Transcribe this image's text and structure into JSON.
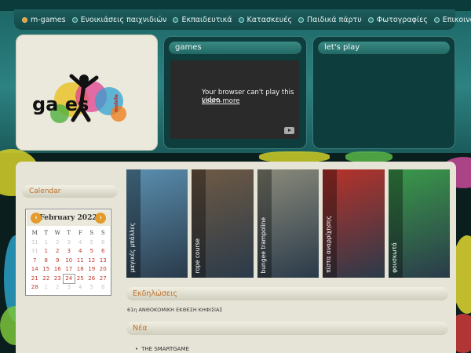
{
  "nav": {
    "items": [
      {
        "label": "m-games"
      },
      {
        "label": "Ενοικιάσεις παιχνιδιών"
      },
      {
        "label": "Εκπαιδευτικά"
      },
      {
        "label": "Κατασκευές"
      },
      {
        "label": "Παιδικά πάρτυ"
      },
      {
        "label": "Φωτογραφίες"
      },
      {
        "label": "Επικοινωνία"
      }
    ]
  },
  "logo": {
    "text": "ga  es",
    "badge": "mobile"
  },
  "games": {
    "title": "games",
    "video_message": "Your browser can't play this video.",
    "video_link": "Learn more"
  },
  "play": {
    "title": "let's play"
  },
  "sidebar": {
    "calendar_title": "Calendar"
  },
  "calendar": {
    "month": "February 2022",
    "prev": "‹",
    "next": "›",
    "weekdays": [
      "M",
      "T",
      "W",
      "T",
      "F",
      "S",
      "S"
    ],
    "days": [
      {
        "d": "31",
        "out": true
      },
      {
        "d": "1"
      },
      {
        "d": "2"
      },
      {
        "d": "3"
      },
      {
        "d": "4"
      },
      {
        "d": "5"
      },
      {
        "d": "6"
      },
      {
        "d": "7"
      },
      {
        "d": "8"
      },
      {
        "d": "9"
      },
      {
        "d": "10"
      },
      {
        "d": "11"
      },
      {
        "d": "12"
      },
      {
        "d": "13"
      },
      {
        "d": "14"
      },
      {
        "d": "15"
      },
      {
        "d": "16"
      },
      {
        "d": "17"
      },
      {
        "d": "18"
      },
      {
        "d": "19"
      },
      {
        "d": "20"
      },
      {
        "d": "21"
      },
      {
        "d": "22"
      },
      {
        "d": "23"
      },
      {
        "d": "24",
        "today": true
      },
      {
        "d": "25"
      },
      {
        "d": "26"
      },
      {
        "d": "27"
      },
      {
        "d": "28"
      },
      {
        "d": "1",
        "out": true
      },
      {
        "d": "2",
        "out": true
      },
      {
        "d": "3",
        "out": true
      },
      {
        "d": "4",
        "out": true
      },
      {
        "d": "5",
        "out": true
      },
      {
        "d": "6",
        "out": true
      }
    ],
    "prev_row": [
      "31",
      "1",
      "2",
      "3",
      "4",
      "5",
      "6"
    ]
  },
  "gallery": [
    {
      "label": "μαγικές μπάλλες",
      "color": "#5a8fb0"
    },
    {
      "label": "rope course",
      "color": "#6f5a44"
    },
    {
      "label": "bungee trampoline",
      "color": "#8a8a7a"
    },
    {
      "label": "πίστα αναρρίχησης",
      "color": "#b8322a"
    },
    {
      "label": "φουσκωτά",
      "color": "#3a9a4a"
    }
  ],
  "events": {
    "title": "Εκδηλώσεις",
    "text": "61η ΑΝΘΟΚΟΜΙΚΗ ΕΚΘΕΣΗ ΚΗΦΙΣΙΑΣ"
  },
  "news": {
    "title": "Νέα",
    "items": [
      "THE SMARTGAME"
    ]
  }
}
